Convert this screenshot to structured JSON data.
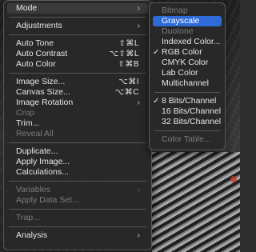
{
  "main_menu": {
    "mode_label": "Mode",
    "adjustments_label": "Adjustments",
    "auto_tone": {
      "label": "Auto Tone",
      "shortcut": "⇧⌘L"
    },
    "auto_contrast": {
      "label": "Auto Contrast",
      "shortcut": "⌥⇧⌘L"
    },
    "auto_color": {
      "label": "Auto Color",
      "shortcut": "⇧⌘B"
    },
    "image_size": {
      "label": "Image Size...",
      "shortcut": "⌥⌘I"
    },
    "canvas_size": {
      "label": "Canvas Size...",
      "shortcut": "⌥⌘C"
    },
    "image_rotation_label": "Image Rotation",
    "crop_label": "Crop",
    "trim_label": "Trim...",
    "reveal_all_label": "Reveal All",
    "duplicate_label": "Duplicate...",
    "apply_image_label": "Apply Image...",
    "calculations_label": "Calculations...",
    "variables_label": "Variables",
    "apply_data_set_label": "Apply Data Set...",
    "trap_label": "Trap...",
    "analysis_label": "Analysis"
  },
  "mode_submenu": {
    "bitmap": "Bitmap",
    "grayscale": "Grayscale",
    "duotone": "Duotone",
    "indexed_color": "Indexed Color...",
    "rgb_color": "RGB Color",
    "cmyk_color": "CMYK Color",
    "lab_color": "Lab Color",
    "multichannel": "Multichannel",
    "bits8": "8 Bits/Channel",
    "bits16": "16 Bits/Channel",
    "bits32": "32 Bits/Channel",
    "color_table": "Color Table...",
    "checkmark": "✓"
  },
  "chevron": "›"
}
